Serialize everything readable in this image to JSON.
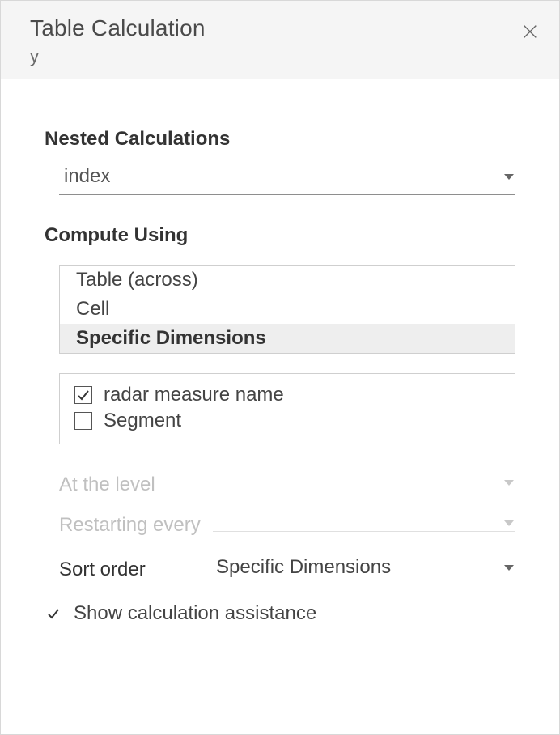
{
  "header": {
    "title": "Table Calculation",
    "subtitle": "y"
  },
  "sections": {
    "nested_label": "Nested Calculations",
    "nested_value": "index",
    "compute_label": "Compute Using",
    "compute_options": {
      "table_across": "Table (across)",
      "cell": "Cell",
      "specific": "Specific Dimensions"
    },
    "dimensions": {
      "radar": "radar measure name",
      "segment": "Segment"
    },
    "at_the_level_label": "At the level",
    "at_the_level_value": "",
    "restarting_label": "Restarting every",
    "restarting_value": "",
    "sort_order_label": "Sort order",
    "sort_order_value": "Specific Dimensions",
    "assist_label": "Show calculation assistance"
  }
}
